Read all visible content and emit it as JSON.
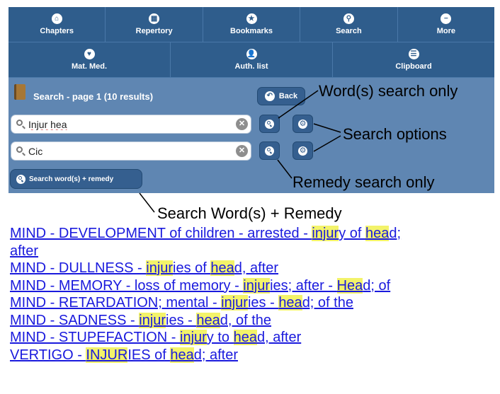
{
  "nav": {
    "row1": [
      {
        "label": "Chapters",
        "icon": "home-icon",
        "glyph": "⌂"
      },
      {
        "label": "Repertory",
        "icon": "grid-icon",
        "glyph": "▦"
      },
      {
        "label": "Bookmarks",
        "icon": "star-icon",
        "glyph": "★"
      },
      {
        "label": "Search",
        "icon": "search-icon",
        "glyph": "⚲"
      },
      {
        "label": "More",
        "icon": "minus-icon",
        "glyph": "−"
      }
    ],
    "row2": [
      {
        "label": "Mat. Med.",
        "icon": "heart-icon",
        "glyph": "♥"
      },
      {
        "label": "Auth. list",
        "icon": "person-icon",
        "glyph": "👤"
      },
      {
        "label": "Clipboard",
        "icon": "list-icon",
        "glyph": "☰"
      }
    ]
  },
  "panel": {
    "title": "Search - page 1 (10 results)",
    "back_label": "Back",
    "word_input_value": "Injur hea",
    "remedy_input_value": "Cic",
    "combined_button_label": "Search word(s) + remedy"
  },
  "annotations": {
    "word_only": "Word(s) search only",
    "options": "Search options",
    "remedy_only": "Remedy search only",
    "combined": "Search Word(s) + Remedy"
  },
  "results": [
    [
      {
        "t": "MIND - DEVELOPMENT of children - arrested - "
      },
      {
        "t": "injur",
        "h": true
      },
      {
        "t": "y of "
      },
      {
        "t": "hea",
        "h": true
      },
      {
        "t": "d;"
      }
    ],
    [
      {
        "t": "after"
      }
    ],
    [
      {
        "t": "MIND - DULLNESS - "
      },
      {
        "t": "injur",
        "h": true
      },
      {
        "t": "ies of "
      },
      {
        "t": "hea",
        "h": true
      },
      {
        "t": "d, after"
      }
    ],
    [
      {
        "t": "MIND - MEMORY - loss of memory - "
      },
      {
        "t": "injur",
        "h": true
      },
      {
        "t": "ies; after - "
      },
      {
        "t": "Hea",
        "h": true
      },
      {
        "t": "d; of"
      }
    ],
    [
      {
        "t": "MIND - RETARDATION; mental - "
      },
      {
        "t": "injur",
        "h": true
      },
      {
        "t": "ies - "
      },
      {
        "t": "hea",
        "h": true
      },
      {
        "t": "d; of the"
      }
    ],
    [
      {
        "t": "MIND - SADNESS - "
      },
      {
        "t": "injur",
        "h": true
      },
      {
        "t": "ies - "
      },
      {
        "t": "hea",
        "h": true
      },
      {
        "t": "d, of the"
      }
    ],
    [
      {
        "t": "MIND - STUPEFACTION - "
      },
      {
        "t": "injur",
        "h": true
      },
      {
        "t": "y to "
      },
      {
        "t": "hea",
        "h": true
      },
      {
        "t": "d, after"
      }
    ],
    [
      {
        "t": "VERTIGO - "
      },
      {
        "t": "INJUR",
        "h": true
      },
      {
        "t": "IES of "
      },
      {
        "t": "hea",
        "h": true
      },
      {
        "t": "d; after"
      }
    ]
  ]
}
